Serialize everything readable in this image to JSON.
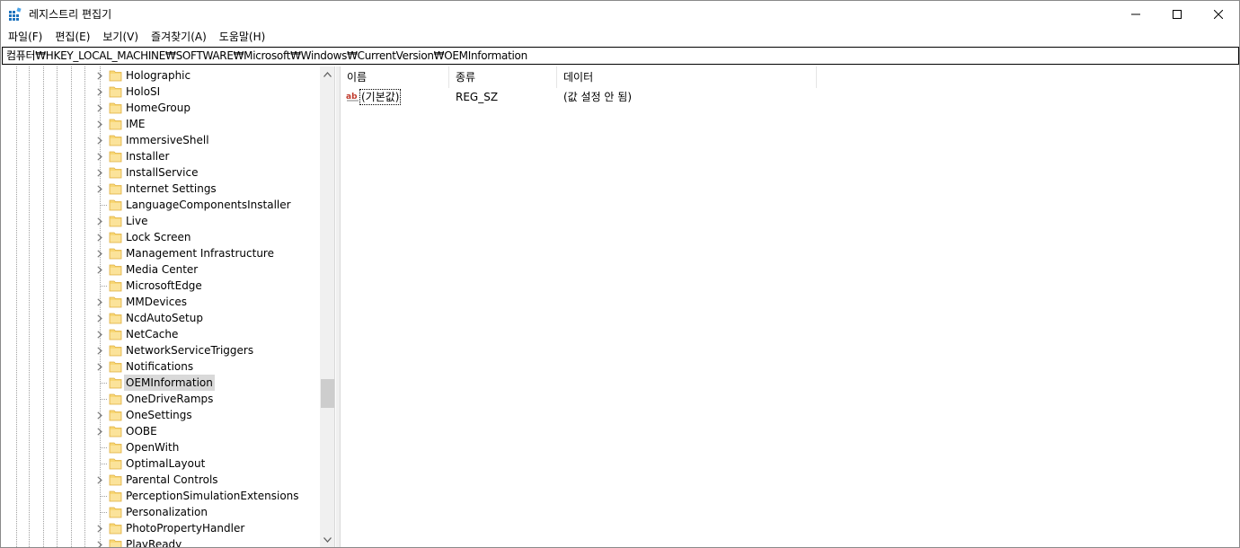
{
  "window": {
    "title": "레지스트리 편집기"
  },
  "menu": [
    "파일(F)",
    "편집(E)",
    "보기(V)",
    "즐겨찾기(A)",
    "도움말(H)"
  ],
  "address": "컴퓨터₩HKEY_LOCAL_MACHINE₩SOFTWARE₩Microsoft₩Windows₩CurrentVersion₩OEMInformation",
  "tree": {
    "items": [
      {
        "label": "Holographic",
        "expandable": true
      },
      {
        "label": "HoloSI",
        "expandable": true
      },
      {
        "label": "HomeGroup",
        "expandable": true
      },
      {
        "label": "IME",
        "expandable": true
      },
      {
        "label": "ImmersiveShell",
        "expandable": true
      },
      {
        "label": "Installer",
        "expandable": true
      },
      {
        "label": "InstallService",
        "expandable": true
      },
      {
        "label": "Internet Settings",
        "expandable": true
      },
      {
        "label": "LanguageComponentsInstaller",
        "expandable": false
      },
      {
        "label": "Live",
        "expandable": true
      },
      {
        "label": "Lock Screen",
        "expandable": true
      },
      {
        "label": "Management Infrastructure",
        "expandable": true
      },
      {
        "label": "Media Center",
        "expandable": true
      },
      {
        "label": "MicrosoftEdge",
        "expandable": false
      },
      {
        "label": "MMDevices",
        "expandable": true
      },
      {
        "label": "NcdAutoSetup",
        "expandable": true
      },
      {
        "label": "NetCache",
        "expandable": true
      },
      {
        "label": "NetworkServiceTriggers",
        "expandable": true
      },
      {
        "label": "Notifications",
        "expandable": true
      },
      {
        "label": "OEMInformation",
        "expandable": false,
        "selected": true
      },
      {
        "label": "OneDriveRamps",
        "expandable": false
      },
      {
        "label": "OneSettings",
        "expandable": true
      },
      {
        "label": "OOBE",
        "expandable": true
      },
      {
        "label": "OpenWith",
        "expandable": false
      },
      {
        "label": "OptimalLayout",
        "expandable": false
      },
      {
        "label": "Parental Controls",
        "expandable": true
      },
      {
        "label": "PerceptionSimulationExtensions",
        "expandable": false
      },
      {
        "label": "Personalization",
        "expandable": false
      },
      {
        "label": "PhotoPropertyHandler",
        "expandable": true
      },
      {
        "label": "PlayReady",
        "expandable": true
      }
    ]
  },
  "list": {
    "columns": {
      "name": "이름",
      "type": "종류",
      "data": "데이터"
    },
    "rows": [
      {
        "name": "(기본값)",
        "type": "REG_SZ",
        "data": "(값 설정 안 됨)",
        "icon": "string-value-icon"
      }
    ]
  },
  "colors": {
    "selection": "#d9d9d9",
    "folder": "#f8d775",
    "folder_edge": "#e0b040",
    "accent": "#0078d7"
  }
}
